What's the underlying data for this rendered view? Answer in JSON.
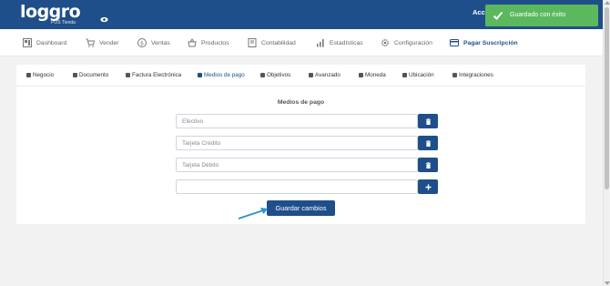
{
  "header": {
    "logo_text": "loggro",
    "logo_sub": "POS Tienda",
    "account_text": "Acce"
  },
  "toast": {
    "message": "Guardado con éxito",
    "color": "#5bb85d"
  },
  "nav": {
    "items": [
      {
        "label": "Dashboard",
        "icon": "dashboard-icon"
      },
      {
        "label": "Vender",
        "icon": "cart-icon"
      },
      {
        "label": "Ventas",
        "icon": "dollar-icon"
      },
      {
        "label": "Productos",
        "icon": "basket-icon"
      },
      {
        "label": "Contabilidad",
        "icon": "ledger-icon"
      },
      {
        "label": "Estadísticas",
        "icon": "bar-chart-icon"
      },
      {
        "label": "Configuración",
        "icon": "gear-icon"
      },
      {
        "label": "Pagar Suscripción",
        "icon": "credit-card-icon"
      }
    ]
  },
  "settings": {
    "tabs": [
      {
        "label": "Negocio"
      },
      {
        "label": "Documento"
      },
      {
        "label": "Factura Electrónica"
      },
      {
        "label": "Medios de pago"
      },
      {
        "label": "Objetivos"
      },
      {
        "label": "Avanzado"
      },
      {
        "label": "Moneda"
      },
      {
        "label": "Ubicación"
      },
      {
        "label": "Integraciones"
      }
    ],
    "active_tab": "Medios de pago",
    "section_title": "Medios de pago",
    "payment_methods": [
      {
        "value": "Efectivo",
        "action": "delete"
      },
      {
        "value": "Tarjeta Crédito",
        "action": "delete"
      },
      {
        "value": "Tarjeta Débito",
        "action": "delete"
      },
      {
        "value": "",
        "action": "add"
      }
    ],
    "save_label": "Guardar cambios"
  },
  "colors": {
    "brand": "#1f4f8a",
    "success": "#5bb85d",
    "annotation_arrow": "#2b93c9"
  }
}
